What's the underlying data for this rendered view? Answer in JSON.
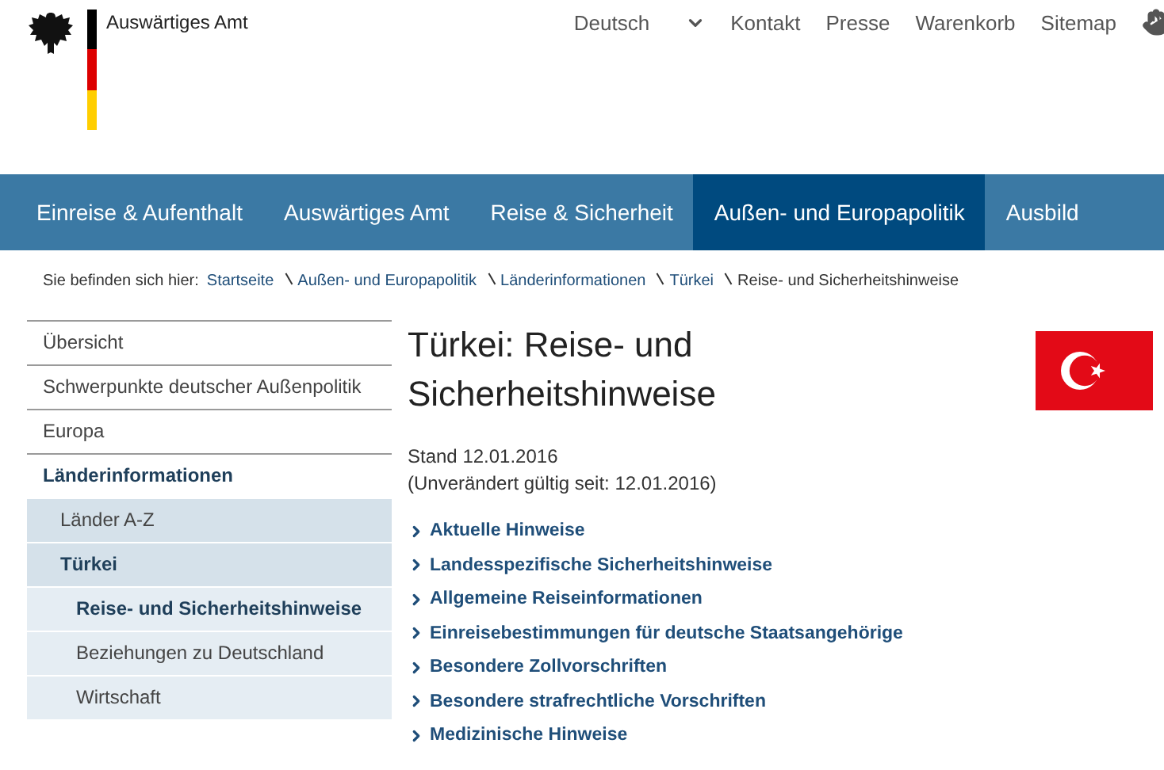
{
  "header": {
    "site_name": "Auswärtiges Amt",
    "language": "Deutsch",
    "links": [
      "Kontakt",
      "Presse",
      "Warenkorb",
      "Sitemap"
    ]
  },
  "nav": [
    {
      "label": "Einreise & Aufenthalt",
      "selected": false
    },
    {
      "label": "Auswärtiges Amt",
      "selected": false
    },
    {
      "label": "Reise & Sicherheit",
      "selected": false
    },
    {
      "label": "Außen- und Europapolitik",
      "selected": true
    },
    {
      "label": "Ausbild",
      "selected": false
    }
  ],
  "breadcrumb": {
    "label": "Sie befinden sich hier:",
    "links": [
      "Startseite",
      "Außen- und Europapolitik",
      "Länderinformationen",
      "Türkei"
    ],
    "current": "Reise- und Sicherheitshinweise"
  },
  "sidebar": [
    {
      "label": "Übersicht",
      "selected": false
    },
    {
      "label": "Schwerpunkte deutscher Außenpolitik",
      "selected": false
    },
    {
      "label": "Europa",
      "selected": false
    },
    {
      "label": "Länderinformationen",
      "selected": true,
      "children": [
        {
          "label": "Länder A-Z",
          "selected": false
        },
        {
          "label": "Türkei",
          "selected": true,
          "children": [
            {
              "label": "Reise- und Sicherheitshinweise",
              "selected": true
            },
            {
              "label": "Beziehungen zu Deutschland",
              "selected": false
            },
            {
              "label": "Wirtschaft",
              "selected": false
            }
          ]
        }
      ]
    }
  ],
  "article": {
    "title": "Türkei: Reise- und Sicherheitshinweise",
    "date": "Stand 12.01.2016",
    "validity": "(Unverändert gültig seit: 12.01.2016)",
    "links": [
      "Aktuelle Hinweise",
      "Landesspezifische Sicherheitshinweise",
      "Allgemeine Reiseinformationen",
      "Einreisebestimmungen für deutsche Staatsangehörige",
      "Besondere Zollvorschriften",
      "Besondere strafrechtliche Vorschriften",
      "Medizinische Hinweise"
    ]
  }
}
